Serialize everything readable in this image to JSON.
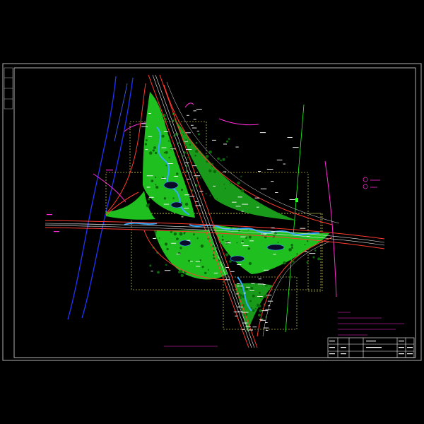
{
  "drawing": {
    "background": "#000000",
    "frame_color": "#ffffff",
    "road_color": "#e8e8e8",
    "road_edge_color": "#ff3b30",
    "planting_color": "#22cc22",
    "planting_dark_color": "#0a7a0a",
    "water_color": "#1f9fff",
    "river_color": "#2233ff",
    "accent_magenta": "#ff2bd6",
    "accent_green_line": "#22ff22",
    "section_box_color": "#ffff66"
  },
  "title_block": {
    "rows": [
      [
        "",
        "",
        "",
        ""
      ],
      [
        "",
        "",
        "",
        ""
      ],
      [
        "",
        "",
        "",
        ""
      ]
    ]
  },
  "legend": {
    "items": [
      {
        "icon": "circle-symbol-icon",
        "label": ""
      },
      {
        "icon": "circle-symbol-icon",
        "label": ""
      }
    ]
  },
  "notes": {
    "lines": [
      "",
      "",
      "",
      ""
    ]
  },
  "plan_title": ""
}
